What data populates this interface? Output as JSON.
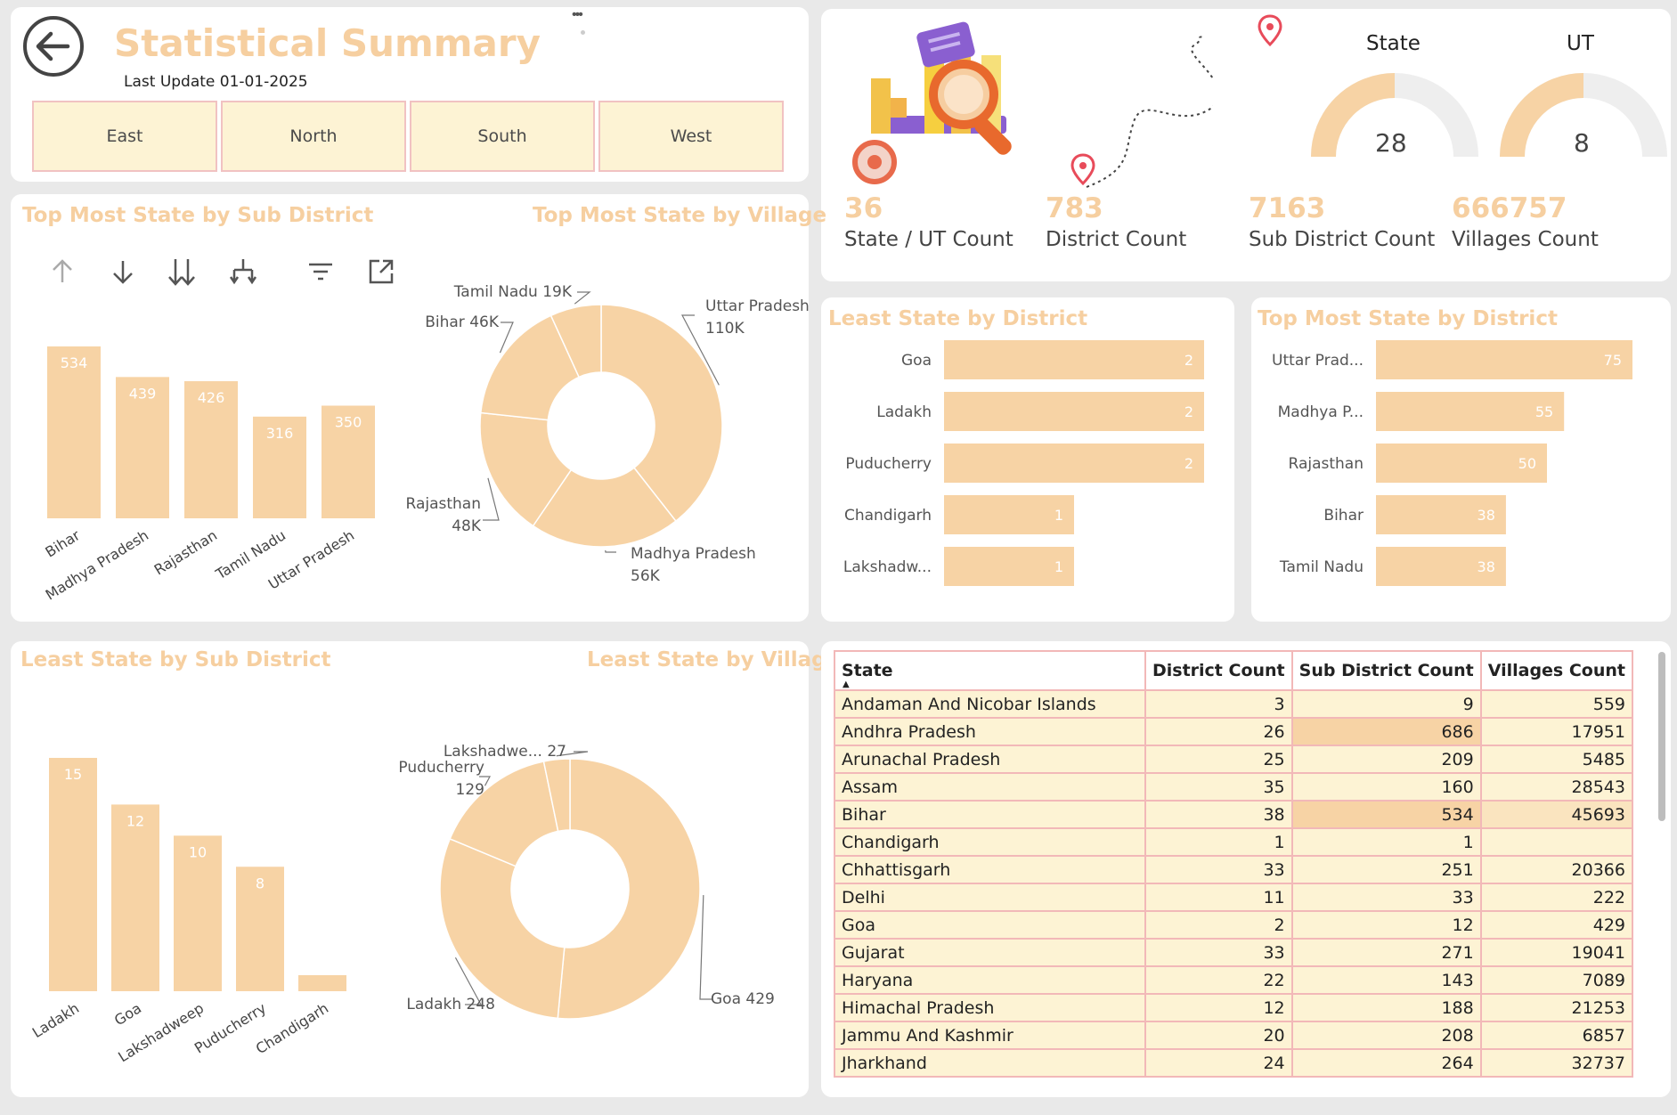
{
  "header": {
    "title": "Statistical Summary",
    "last_update": "Last Update 01-01-2025",
    "regions": [
      "East",
      "North",
      "South",
      "West"
    ]
  },
  "gauges": [
    {
      "label": "State",
      "value": "28",
      "fraction": 0.5
    },
    {
      "label": "UT",
      "value": "8",
      "fraction": 0.5
    }
  ],
  "kpis": [
    {
      "value": "36",
      "label": "State / UT Count"
    },
    {
      "value": "783",
      "label": "District Count"
    },
    {
      "value": "7163",
      "label": "Sub District Count"
    },
    {
      "value": "666757",
      "label": "Villages Count"
    }
  ],
  "panel_titles": {
    "top_sub": "Top Most State by Sub District",
    "top_village": "Top Most State by Village",
    "least_district": "Least State by District",
    "top_district": "Top Most State by District",
    "least_sub": "Least State by Sub District",
    "least_village": "Least State by Village"
  },
  "chart_data": [
    {
      "id": "top-sub-district",
      "type": "bar",
      "categories": [
        "Bihar",
        "Madhya Pradesh",
        "Rajasthan",
        "Tamil Nadu",
        "Uttar Pradesh"
      ],
      "values": [
        534,
        439,
        426,
        316,
        350
      ],
      "labels": [
        "534",
        "439",
        "426",
        "316",
        "350"
      ],
      "ylim": [
        0,
        534
      ]
    },
    {
      "id": "top-village",
      "type": "pie",
      "donut": true,
      "categories": [
        "Uttar Pradesh",
        "Madhya Pradesh",
        "Rajasthan",
        "Bihar",
        "Tamil Nadu"
      ],
      "values": [
        110,
        56,
        48,
        46,
        19
      ],
      "labels": [
        "Uttar Pradesh 110K",
        "Madhya Pradesh 56K",
        "Rajasthan 48K",
        "Bihar 46K",
        "Tamil Nadu 19K"
      ]
    },
    {
      "id": "least-district",
      "type": "bar",
      "orientation": "horizontal",
      "categories": [
        "Goa",
        "Ladakh",
        "Puducherry",
        "Chandigarh",
        "Lakshadw..."
      ],
      "values": [
        2,
        2,
        2,
        1,
        1
      ],
      "labels": [
        "2",
        "2",
        "2",
        "1",
        "1"
      ],
      "xlim": [
        0,
        2
      ]
    },
    {
      "id": "top-district",
      "type": "bar",
      "orientation": "horizontal",
      "categories": [
        "Uttar Prad...",
        "Madhya P...",
        "Rajasthan",
        "Bihar",
        "Tamil Nadu"
      ],
      "values": [
        75,
        55,
        50,
        38,
        38
      ],
      "labels": [
        "75",
        "55",
        "50",
        "38",
        "38"
      ],
      "xlim": [
        0,
        75
      ]
    },
    {
      "id": "least-sub-district",
      "type": "bar",
      "categories": [
        "Ladakh",
        "Goa",
        "Lakshadweep",
        "Puducherry",
        "Chandigarh"
      ],
      "values": [
        15,
        12,
        10,
        8,
        1
      ],
      "labels": [
        "15",
        "12",
        "10",
        "8",
        ""
      ],
      "ylim": [
        0,
        15
      ]
    },
    {
      "id": "least-village",
      "type": "pie",
      "donut": true,
      "categories": [
        "Goa",
        "Ladakh",
        "Puducherry",
        "Lakshadweep"
      ],
      "values": [
        429,
        248,
        129,
        27
      ],
      "labels": [
        "Goa 429",
        "Ladakh 248",
        "Puducherry 129",
        "Lakshadwe... 27"
      ]
    }
  ],
  "table": {
    "columns": [
      "State",
      "District Count",
      "Sub District Count",
      "Villages Count"
    ],
    "rows": [
      [
        "Andaman And Nicobar Islands",
        "3",
        "9",
        "559"
      ],
      [
        "Andhra Pradesh",
        "26",
        "686",
        "17951"
      ],
      [
        "Arunachal Pradesh",
        "25",
        "209",
        "5485"
      ],
      [
        "Assam",
        "35",
        "160",
        "28543"
      ],
      [
        "Bihar",
        "38",
        "534",
        "45693"
      ],
      [
        "Chandigarh",
        "1",
        "1",
        ""
      ],
      [
        "Chhattisgarh",
        "33",
        "251",
        "20366"
      ],
      [
        "Delhi",
        "11",
        "33",
        "222"
      ],
      [
        "Goa",
        "2",
        "12",
        "429"
      ],
      [
        "Gujarat",
        "33",
        "271",
        "19041"
      ],
      [
        "Haryana",
        "22",
        "143",
        "7089"
      ],
      [
        "Himachal Pradesh",
        "12",
        "188",
        "21253"
      ],
      [
        "Jammu And Kashmir",
        "20",
        "208",
        "6857"
      ],
      [
        "Jharkhand",
        "24",
        "264",
        "32737"
      ]
    ]
  },
  "colors": {
    "bar": "#f7d3a5",
    "accent": "#f6cfa0",
    "cell": "#fdf3d4",
    "border": "#f2b8b8",
    "pin": "#e84b5a"
  }
}
